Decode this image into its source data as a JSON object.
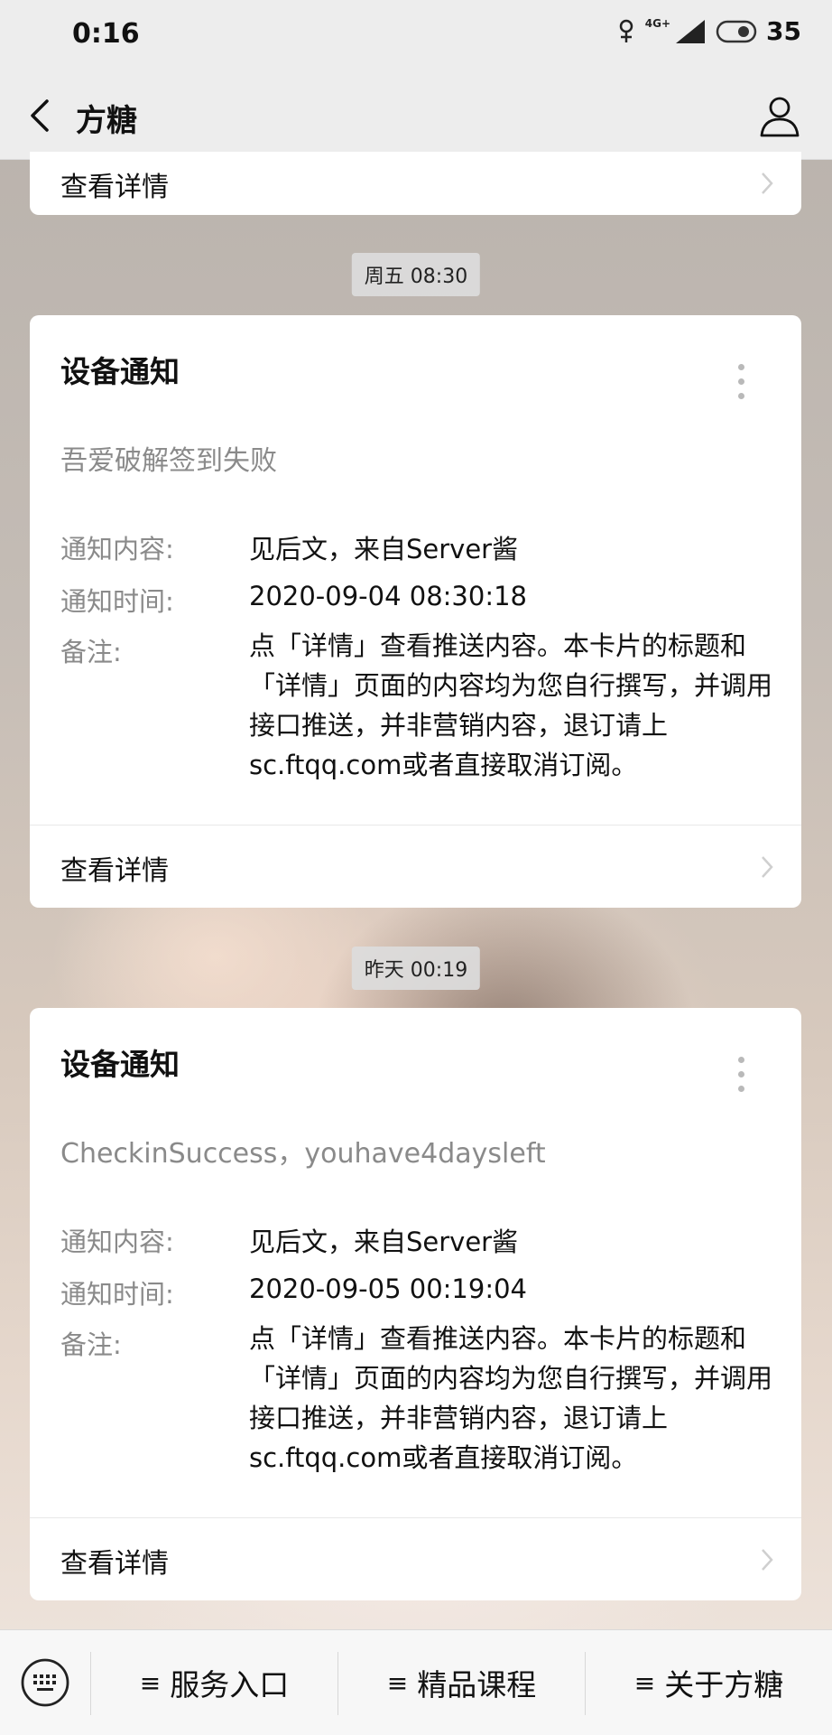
{
  "status": {
    "time": "0:16",
    "network": "4G+",
    "battery": "35"
  },
  "header": {
    "title": "方糖"
  },
  "top_card": {
    "detail_label": "查看详情"
  },
  "messages": [
    {
      "timestamp": "周五 08:30",
      "title": "设备通知",
      "summary": "吾爱破解签到失败",
      "content_label": "通知内容:",
      "content_value": "见后文，来自Server酱",
      "time_label": "通知时间:",
      "time_value": "2020-09-04 08:30:18",
      "note_label": "备注:",
      "note_value": "点「详情」查看推送内容。本卡片的标题和「详情」页面的内容均为您自行撰写，并调用接口推送，并非营销内容，退订请上sc.ftqq.com或者直接取消订阅。",
      "detail_label": "查看详情"
    },
    {
      "timestamp": "昨天 00:19",
      "title": "设备通知",
      "summary": "CheckinSuccess，youhave4daysleft",
      "content_label": "通知内容:",
      "content_value": "见后文，来自Server酱",
      "time_label": "通知时间:",
      "time_value": "2020-09-05 00:19:04",
      "note_label": "备注:",
      "note_value": "点「详情」查看推送内容。本卡片的标题和「详情」页面的内容均为您自行撰写，并调用接口推送，并非营销内容，退订请上sc.ftqq.com或者直接取消订阅。",
      "detail_label": "查看详情"
    }
  ],
  "bottom_menu": [
    {
      "label": "服务入口"
    },
    {
      "label": "精品课程"
    },
    {
      "label": "关于方糖"
    }
  ],
  "icons": {
    "back": "chevron-left-icon",
    "profile": "person-icon",
    "keyboard": "keyboard-icon",
    "more": "more-vertical-icon",
    "menu": "menu-lines-icon"
  }
}
